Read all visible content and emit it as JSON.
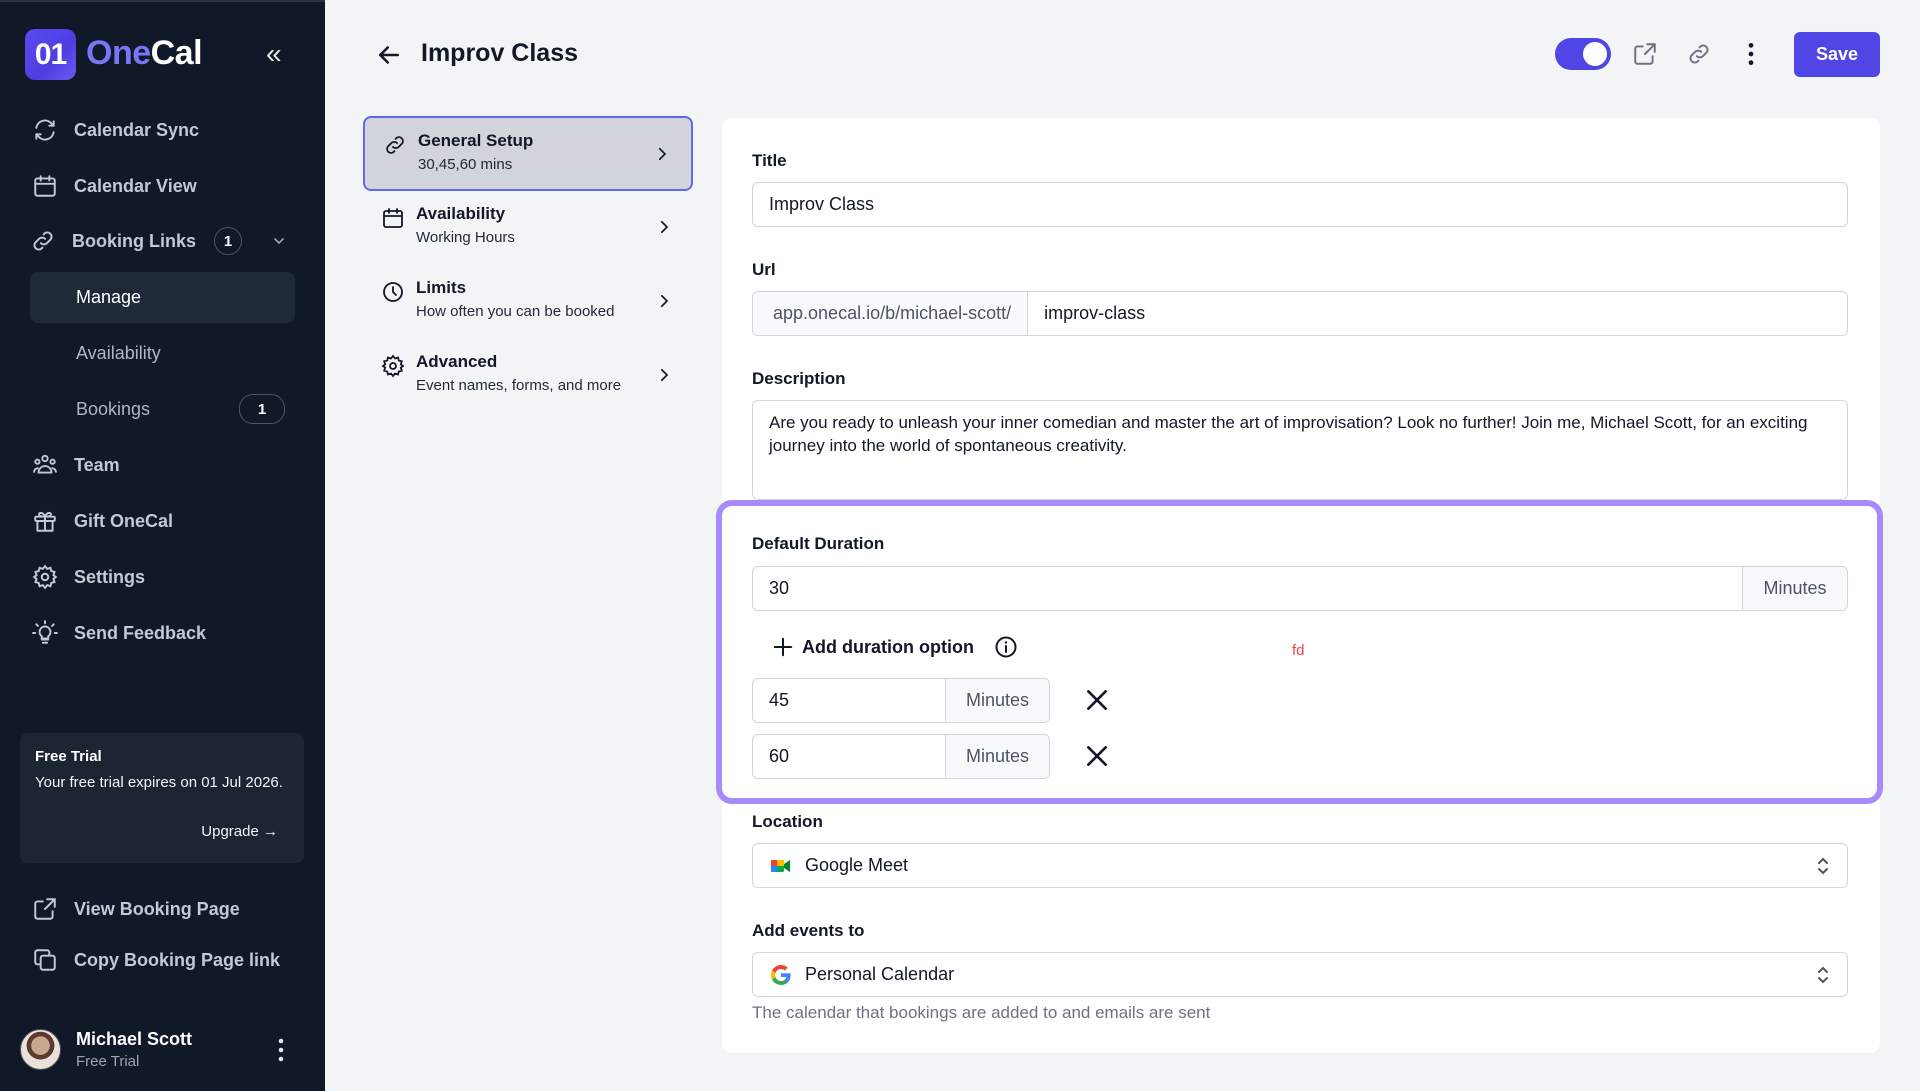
{
  "app": {
    "brand_mark": "01",
    "brand_name_a": "One",
    "brand_name_b": "Cal",
    "collapse_glyph": "«"
  },
  "sidebar": {
    "items": [
      {
        "label": "Calendar Sync",
        "icon": "refresh-icon"
      },
      {
        "label": "Calendar View",
        "icon": "calendar-icon"
      },
      {
        "label": "Booking Links",
        "icon": "link-icon",
        "badge": "1"
      },
      {
        "label": "Manage"
      },
      {
        "label": "Availability"
      },
      {
        "label": "Bookings",
        "badge": "1"
      },
      {
        "label": "Team",
        "icon": "users-icon"
      },
      {
        "label": "Gift OneCal",
        "icon": "gift-icon"
      },
      {
        "label": "Settings",
        "icon": "gear-icon"
      },
      {
        "label": "Send Feedback",
        "icon": "lightbulb-icon"
      }
    ],
    "trial": {
      "title": "Free Trial",
      "text": "Your free trial expires on 01 Jul 2026.",
      "upgrade": "Upgrade →"
    },
    "footer_links": [
      {
        "label": "View Booking Page",
        "icon": "external-link-icon"
      },
      {
        "label": "Copy Booking Page link",
        "icon": "copy-icon"
      }
    ],
    "user": {
      "name": "Michael Scott",
      "plan": "Free Trial"
    }
  },
  "header": {
    "title": "Improv Class",
    "toggle_on": true,
    "save_label": "Save"
  },
  "tabs": [
    {
      "label": "General Setup",
      "sub": "30,45,60 mins",
      "icon": "link-icon",
      "active": true
    },
    {
      "label": "Availability",
      "sub": "Working Hours",
      "icon": "calendar-icon"
    },
    {
      "label": "Limits",
      "sub": "How often you can be booked",
      "icon": "clock-icon"
    },
    {
      "label": "Advanced",
      "sub": "Event names, forms, and more",
      "icon": "gear-icon"
    }
  ],
  "form": {
    "title_label": "Title",
    "title_value": "Improv Class",
    "url_label": "Url",
    "url_prefix": "app.onecal.io/b/michael-scott/",
    "url_slug": "improv-class",
    "description_label": "Description",
    "description_value": "Are you ready to unleash your inner comedian and master the art of improvisation? Look no further! Join me, Michael Scott, for an exciting journey into the world of spontaneous creativity.",
    "default_duration_label": "Default Duration",
    "default_duration_value": "30",
    "unit": "Minutes",
    "add_duration_label": "Add duration option",
    "stray_text": "fd",
    "duration_options": [
      {
        "value": "45",
        "unit": "Minutes"
      },
      {
        "value": "60",
        "unit": "Minutes"
      }
    ],
    "location_label": "Location",
    "location_value": "Google Meet",
    "add_events_label": "Add events to",
    "add_events_value": "Personal Calendar",
    "add_events_help": "The calendar that bookings are added to and emails are sent"
  },
  "colors": {
    "accent": "#4f46e5",
    "highlight": "#a78bfa",
    "sidebar_bg": "#111827",
    "error_text": "#ef4444"
  }
}
